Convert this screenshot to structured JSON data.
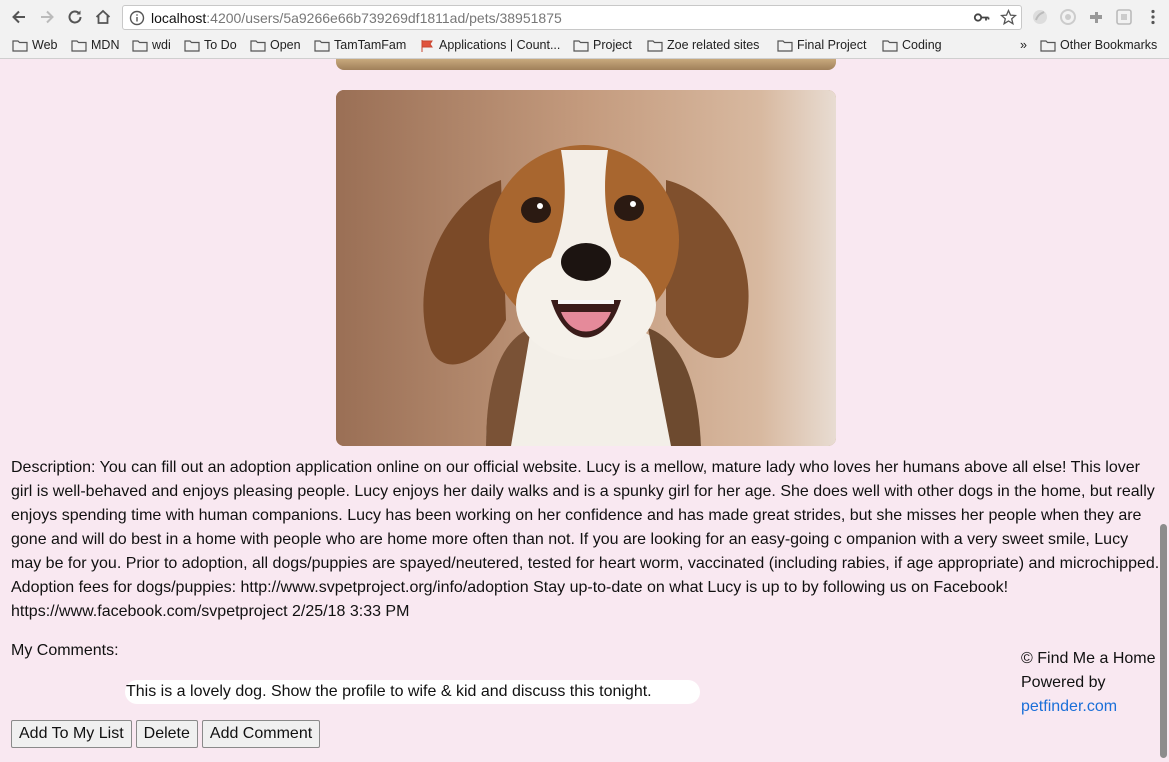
{
  "browser": {
    "url_host": "localhost",
    "url_path": ":4200/users/5a9266e66b739269df1811ad/pets/38951875",
    "bookmarks": [
      "Web",
      "MDN",
      "wdi",
      "To Do",
      "Open",
      "TamTamFam",
      "Applications | Count...",
      "Project",
      "Zoe related sites",
      "Final Project",
      "Coding",
      "Other Bookmarks"
    ],
    "more_bookmarks": "»"
  },
  "pet": {
    "photo": "beagle-photo",
    "description": "Description: You can fill out an adoption application online on our official website. Lucy is a mellow, mature lady who loves her humans above all else! This lover girl is well-behaved and enjoys pleasing people. Lucy enjoys her daily walks and is a spunky girl for her age. She does well with other dogs in the home, but really enjoys spending time with human companions. Lucy has been working on her confidence and has made great strides, but she misses her people when they are gone and will do best in a home with people who are home more often than not. If you are looking for an easy-going c ompanion with a very sweet smile, Lucy may be for you. Prior to adoption, all dogs/puppies are spayed/neutered, tested for heart worm, vaccinated (including rabies, if age appropriate) and microchipped. Adoption fees for dogs/puppies: http://www.svpetproject.org/info/adoption Stay up-to-date on what Lucy is up to by following us on Facebook! https://www.facebook.com/svpetproject 2/25/18 3:33 PM"
  },
  "comments": {
    "label": "My Comments:",
    "text": "This is a lovely dog. Show the profile to wife & kid and discuss this tonight."
  },
  "actions": {
    "add_to_list": "Add To My List",
    "delete": "Delete",
    "add_comment": "Add Comment"
  },
  "footer": {
    "copyright": "© Find Me a Home",
    "powered_by": "Powered by",
    "link": "petfinder.com"
  },
  "colors": {
    "page_bg": "#f9e8f1",
    "link": "#1a6fd8"
  }
}
